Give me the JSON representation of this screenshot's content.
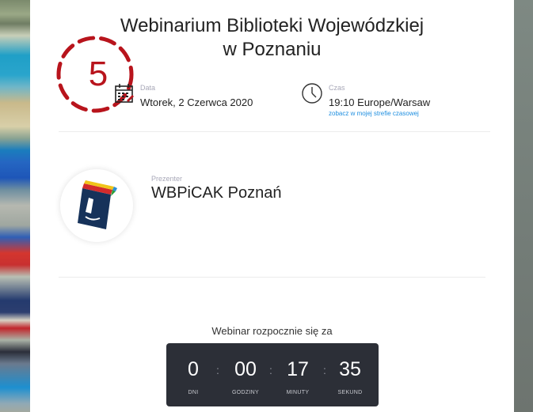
{
  "title": {
    "line1": "Webinarium Biblioteki Wojewódzkiej",
    "line2": "w Poznaniu"
  },
  "annotation": {
    "number": "5",
    "color": "#b8141c"
  },
  "date": {
    "label": "Data",
    "value": "Wtorek, 2 Czerwca 2020",
    "icon": "calendar-icon"
  },
  "time": {
    "label": "Czas",
    "value": "19:10 Europe/Warsaw",
    "timezone_link": "zobacz w mojej strefie czasowej",
    "icon": "clock-icon"
  },
  "presenter": {
    "label": "Prezenter",
    "name": "WBPiCAK Poznań",
    "logo_color": "#16325a"
  },
  "countdown": {
    "label": "Webinar rozpocznie się za",
    "units": [
      {
        "value": "0",
        "label": "DNI"
      },
      {
        "value": "00",
        "label": "GODZINY"
      },
      {
        "value": "17",
        "label": "MINUTY"
      },
      {
        "value": "35",
        "label": "SEKUND"
      }
    ],
    "separator": ":"
  },
  "colors": {
    "accent_link": "#1f8fe0",
    "countdown_bg": "#2c2f37",
    "label_gray": "#a8a8b8"
  }
}
